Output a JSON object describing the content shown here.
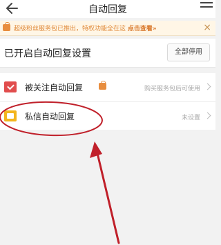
{
  "header": {
    "title": "自动回复"
  },
  "banner": {
    "text": "超级粉丝服务包已推出，特权功能全在这 ",
    "link": "点击查看»",
    "close": "×"
  },
  "section": {
    "title": "已开启自动回复设置",
    "stop_all": "全部停用"
  },
  "rows": [
    {
      "label": "被关注自动回复",
      "status": "购买服务包后可使用",
      "icon": "red-reply-icon"
    },
    {
      "label": "私信自动回复",
      "status": "未设置",
      "icon": "yellow-message-icon"
    }
  ],
  "colors": {
    "annotation": "#c0202a",
    "banner_text": "#e08a3a"
  }
}
